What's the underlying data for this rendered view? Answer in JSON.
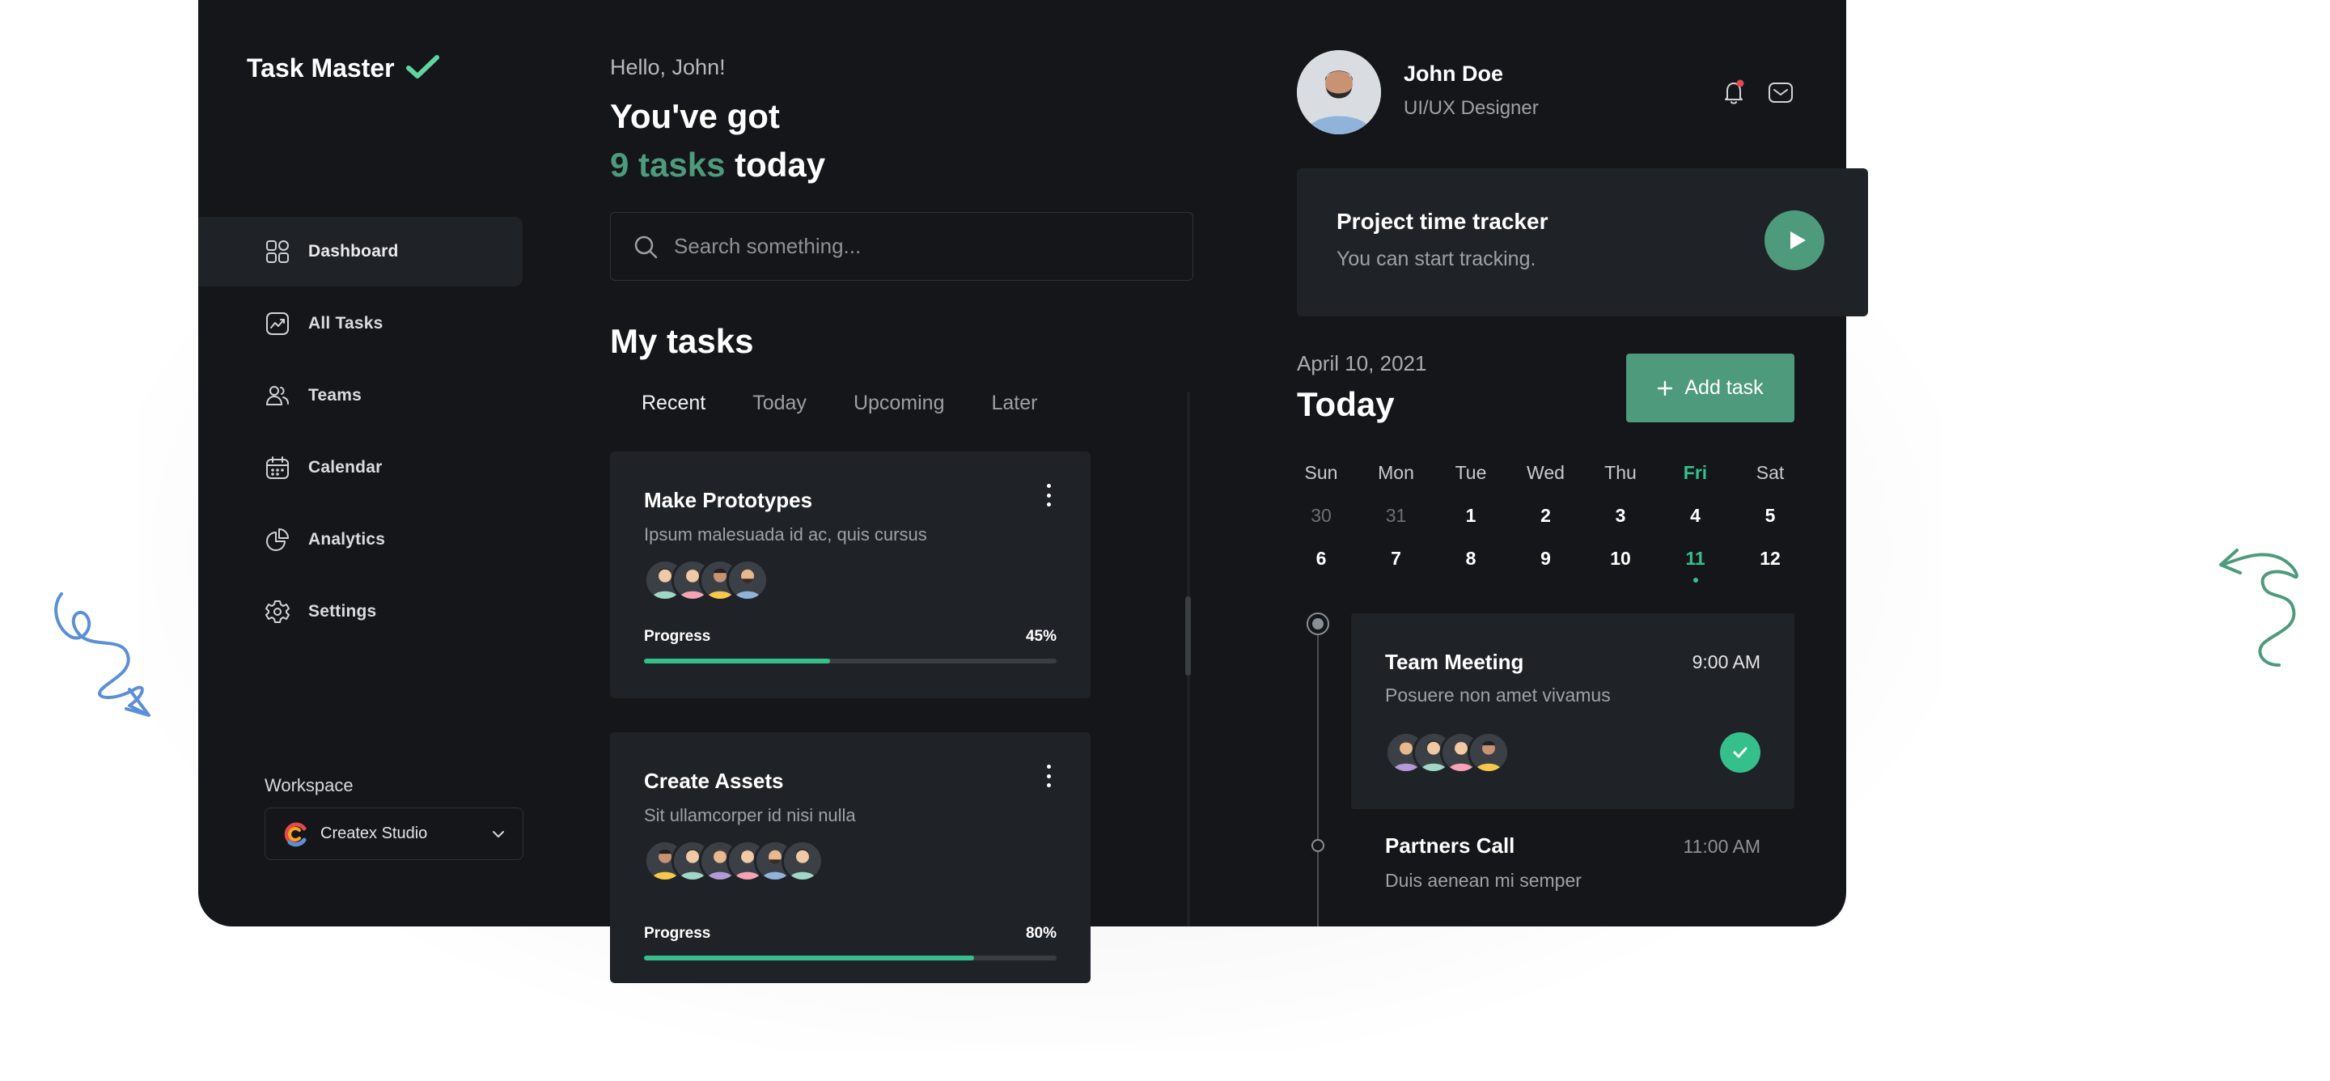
{
  "app": {
    "name": "Task Master"
  },
  "sidebar": {
    "items": [
      {
        "label": "Dashboard",
        "icon": "dashboard-grid-icon",
        "active": true
      },
      {
        "label": "All Tasks",
        "icon": "chart-line-icon",
        "active": false
      },
      {
        "label": "Teams",
        "icon": "users-icon",
        "active": false
      },
      {
        "label": "Calendar",
        "icon": "calendar-icon",
        "active": false
      },
      {
        "label": "Analytics",
        "icon": "pie-chart-icon",
        "active": false
      },
      {
        "label": "Settings",
        "icon": "gear-icon",
        "active": false
      }
    ],
    "workspace_label": "Workspace",
    "workspace_selected": "Createx Studio"
  },
  "main": {
    "greeting": "Hello, John!",
    "headline_line1": "You've got",
    "headline_count": "9 tasks",
    "headline_suffix": "today",
    "search_placeholder": "Search something...",
    "section_title": "My tasks",
    "tabs": [
      {
        "label": "Recent",
        "active": true
      },
      {
        "label": "Today",
        "active": false
      },
      {
        "label": "Upcoming",
        "active": false
      },
      {
        "label": "Later",
        "active": false
      }
    ],
    "tasks": [
      {
        "title": "Make Prototypes",
        "description": "Ipsum malesuada id ac, quis cursus",
        "progress_label": "Progress",
        "progress_text": "45%",
        "progress": 0.45,
        "member_count": 4
      },
      {
        "title": "Create Assets",
        "description": "Sit ullamcorper id nisi nulla",
        "progress_label": "Progress",
        "progress_text": "80%",
        "progress": 0.8,
        "member_count": 6
      }
    ]
  },
  "profile": {
    "name": "John Doe",
    "role": "UI/UX Designer",
    "notification_dot_color": "#e5484d"
  },
  "tracker": {
    "title": "Project time tracker",
    "subtitle": "You can start tracking."
  },
  "schedule": {
    "date": "April 10, 2021",
    "heading": "Today",
    "add_button": "Add task",
    "weekdays": [
      "Sun",
      "Mon",
      "Tue",
      "Wed",
      "Thu",
      "Fri",
      "Sat"
    ],
    "highlight_weekday": "Fri",
    "weeks": [
      [
        {
          "d": "30",
          "muted": true
        },
        {
          "d": "31",
          "muted": true
        },
        {
          "d": "1"
        },
        {
          "d": "2"
        },
        {
          "d": "3"
        },
        {
          "d": "4"
        },
        {
          "d": "5"
        }
      ],
      [
        {
          "d": "6"
        },
        {
          "d": "7"
        },
        {
          "d": "8"
        },
        {
          "d": "9"
        },
        {
          "d": "10"
        },
        {
          "d": "11",
          "selected": true
        },
        {
          "d": "12"
        }
      ]
    ],
    "events": [
      {
        "title": "Team Meeting",
        "time": "9:00 AM",
        "description": "Posuere non amet vivamus",
        "done": true,
        "member_count": 4
      },
      {
        "title": "Partners Call",
        "time": "11:00 AM",
        "description": "Duis aenean mi semper"
      }
    ]
  },
  "colors": {
    "accent": "#4e9a7c",
    "progress": "#35c08b",
    "background": "#141619",
    "card": "#1f2226"
  }
}
